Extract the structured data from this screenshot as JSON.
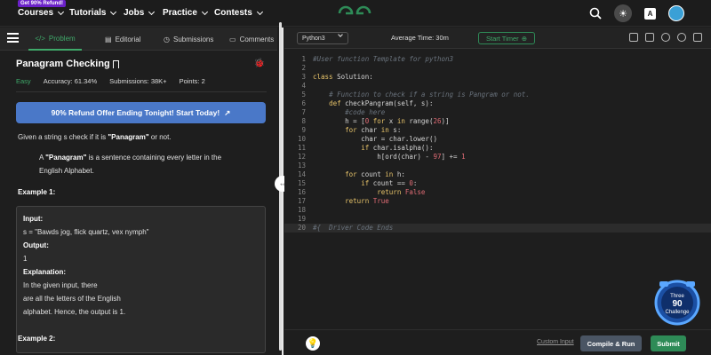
{
  "topnav": {
    "promo_badge": "Get 90% Refund!",
    "items": [
      {
        "label": "Courses"
      },
      {
        "label": "Tutorials"
      },
      {
        "label": "Jobs"
      },
      {
        "label": "Practice"
      },
      {
        "label": "Contests"
      }
    ],
    "icons": [
      "search-icon",
      "theme-toggle-icon",
      "translate-icon",
      "avatar"
    ],
    "brand_color": "#2e8b57"
  },
  "left": {
    "tabs": [
      {
        "label": "Problem",
        "icon": "code-icon",
        "active": true
      },
      {
        "label": "Editorial",
        "icon": "document-icon"
      },
      {
        "label": "Submissions",
        "icon": "clock-icon"
      },
      {
        "label": "Comments",
        "icon": "comment-icon"
      }
    ],
    "title": "Panagram Checking",
    "difficulty": "Easy",
    "accuracy": "Accuracy: 61.34%",
    "submissions": "Submissions: 38K+",
    "points": "Points: 2",
    "refund_button": "90% Refund Offer Ending Tonight! Start Today!",
    "description_prefix": "Given a string s check if it is ",
    "description_bold": "\"Panagram\"",
    "description_suffix": " or not.",
    "definition_line1_prefix": "A ",
    "definition_line1_bold": "\"Panagram\"",
    "definition_line1_suffix": " is a sentence containing every letter in the",
    "definition_line2": "English Alphabet.",
    "example1_title": "Example 1:",
    "example1": {
      "input_label": "Input:",
      "input_value": "s = \"Bawds jog, flick quartz, vex nymph\"",
      "output_label": "Output:",
      "output_value": "1",
      "explanation_label": "Explanation:",
      "explanation_lines": [
        "In  the  given  input,  there",
        "are all the letters of the English",
        "alphabet. Hence, the output is  1."
      ]
    },
    "example2_title": "Example 2:"
  },
  "editor": {
    "language": "Python3",
    "avg_time": "Average Time: 30m",
    "timer_button": "Start Timer",
    "lines": [
      {
        "n": "1",
        "html": "<span class='cm'>#User function Template for python3</span>"
      },
      {
        "n": "2",
        "html": ""
      },
      {
        "n": "3",
        "html": "<span class='kw'>class</span> Solution:"
      },
      {
        "n": "4",
        "html": ""
      },
      {
        "n": "5",
        "html": "    <span class='cm'># Function to check if a string is Pangram or not.</span>"
      },
      {
        "n": "6",
        "html": "    <span class='kw'>def</span> checkPangram(self, s):"
      },
      {
        "n": "7",
        "html": "        <span class='cm'>#code here</span>"
      },
      {
        "n": "8",
        "html": "        h = [<span class='num'>0</span> <span class='kw'>for</span> x <span class='kw'>in</span> range(<span class='num'>26</span>)]"
      },
      {
        "n": "9",
        "html": "        <span class='kw'>for</span> char <span class='kw'>in</span> s:"
      },
      {
        "n": "10",
        "html": "            char = char.lower()"
      },
      {
        "n": "11",
        "html": "            <span class='kw'>if</span> char.isalpha():"
      },
      {
        "n": "12",
        "html": "                h[ord(char) - <span class='num'>97</span>] += <span class='num'>1</span>"
      },
      {
        "n": "13",
        "html": ""
      },
      {
        "n": "14",
        "html": "        <span class='kw'>for</span> count <span class='kw'>in</span> h:"
      },
      {
        "n": "15",
        "html": "            <span class='kw'>if</span> count == <span class='num'>0</span>:"
      },
      {
        "n": "16",
        "html": "                <span class='kw'>return</span> <span class='str'>False</span>"
      },
      {
        "n": "17",
        "html": "        <span class='kw'>return</span> <span class='str'>True</span>"
      },
      {
        "n": "18",
        "html": ""
      },
      {
        "n": "19",
        "html": ""
      },
      {
        "n": "20",
        "html": "<span class='cm'>#{  Driver Code Ends</span>"
      }
    ],
    "custom_input": "Custom Input",
    "compile_button": "Compile & Run",
    "submit_button": "Submit"
  },
  "challenge_badge": {
    "line1": "Three",
    "line2": "90",
    "line3": "Challenge"
  }
}
